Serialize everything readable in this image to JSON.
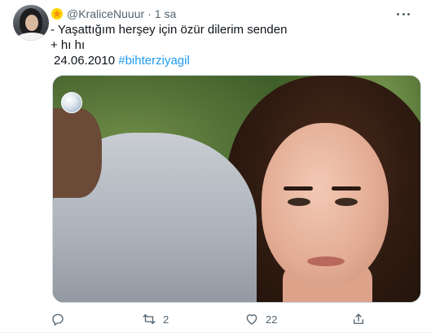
{
  "tweet": {
    "handle": "@KraliceNuuur",
    "separator": "·",
    "time": "1 sa",
    "lines": [
      "- Yaşattığım herşey için özür dilerim senden",
      "+ hı hı"
    ],
    "date": "24.06.2010",
    "hashtag": "#bihterziyagil",
    "media_icon": "kanal-d-logo"
  },
  "actions": {
    "reply_count": "",
    "retweet_count": "2",
    "like_count": "22",
    "share_count": ""
  },
  "icons": {
    "badge": "star-badge-icon",
    "more": "more-options-icon",
    "reply": "reply-icon",
    "retweet": "retweet-icon",
    "like": "heart-icon",
    "share": "share-icon"
  },
  "colors": {
    "accent": "#1d9bf0",
    "muted": "#536471",
    "text": "#0f1419"
  }
}
